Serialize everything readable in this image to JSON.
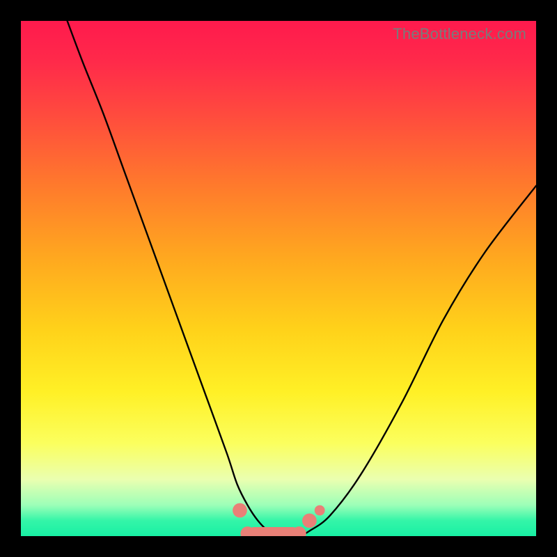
{
  "watermark": {
    "text": "TheBottleneck.com"
  },
  "chart_data": {
    "type": "line",
    "title": "",
    "xlabel": "",
    "ylabel": "",
    "xlim": [
      0,
      100
    ],
    "ylim": [
      0,
      100
    ],
    "grid": false,
    "legend": false,
    "series": [
      {
        "name": "bottleneck-curve",
        "color": "#000000",
        "x": [
          9,
          12,
          16,
          20,
          24,
          28,
          32,
          36,
          40,
          42,
          44,
          46,
          48,
          50,
          52,
          54,
          56,
          60,
          66,
          74,
          82,
          90,
          100
        ],
        "y": [
          100,
          92,
          82,
          71,
          60,
          49,
          38,
          27,
          16,
          10,
          6,
          3,
          1,
          0,
          0,
          0,
          1,
          4,
          12,
          26,
          42,
          55,
          68
        ]
      }
    ],
    "markers": [
      {
        "name": "flat-segment-marker",
        "shape": "rounded-bar",
        "color": "#e98077",
        "x_range": [
          44,
          54
        ],
        "y": 0.5,
        "thickness_pct": 2.5
      },
      {
        "name": "left-dot",
        "shape": "circle",
        "color": "#e98077",
        "x": 42.5,
        "y": 5,
        "r_pct": 1.4
      },
      {
        "name": "right-dot",
        "shape": "circle",
        "color": "#e98077",
        "x": 56,
        "y": 3,
        "r_pct": 1.4
      },
      {
        "name": "right-dot-2",
        "shape": "circle",
        "color": "#e98077",
        "x": 58,
        "y": 5,
        "r_pct": 1.0
      }
    ]
  }
}
